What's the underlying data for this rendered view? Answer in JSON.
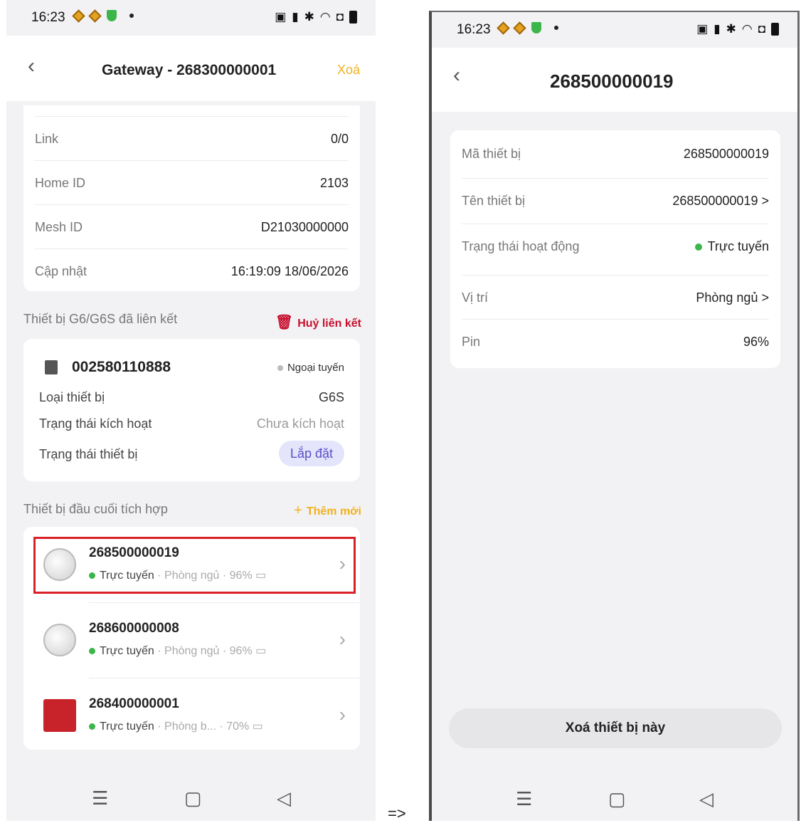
{
  "transition_arrow": "=>",
  "left": {
    "status": {
      "time": "16:23"
    },
    "header": {
      "title": "Gateway - 268300000001",
      "delete_label": "Xoá"
    },
    "info_rows": [
      {
        "key": "Link",
        "value": "0/0"
      },
      {
        "key": "Home ID",
        "value": "2103"
      },
      {
        "key": "Mesh ID",
        "value": "D21030000000"
      },
      {
        "key": "Cập nhật",
        "value": "16:19:09 18/06/2026"
      }
    ],
    "linked_section": {
      "title": "Thiết bị G6/G6S đã liên kết",
      "action": "Huỷ liên kết"
    },
    "linked_device": {
      "id": "002580110888",
      "status": "Ngoại tuyến",
      "rows": [
        {
          "key": "Loại thiết bị",
          "value": "G6S"
        },
        {
          "key": "Trạng thái kích hoạt",
          "value": "Chưa kích hoạt"
        },
        {
          "key": "Trạng thái thiết bị",
          "value": "Lắp đặt"
        }
      ]
    },
    "end_devices_section": {
      "title": "Thiết bị đầu cuối tích hợp",
      "action": "Thêm mới"
    },
    "end_devices": [
      {
        "id": "268500000019",
        "status": "Trực tuyến",
        "location": "Phòng ngủ",
        "battery": "96%"
      },
      {
        "id": "268600000008",
        "status": "Trực tuyến",
        "location": "Phòng ngủ",
        "battery": "96%"
      },
      {
        "id": "268400000001",
        "status": "Trực tuyến",
        "location": "Phòng b...",
        "battery": "70%"
      }
    ],
    "highlight_color": "#d92128",
    "accent_color": "#f2b01e",
    "danger_color": "#c8102e"
  },
  "right": {
    "status": {
      "time": "16:23"
    },
    "header": {
      "title": "268500000019"
    },
    "rows": [
      {
        "key": "Mã thiết bị",
        "value": "268500000019",
        "chevron": ""
      },
      {
        "key": "Tên thiết bị",
        "value": "268500000019",
        "chevron": ">"
      },
      {
        "key": "Trạng thái hoạt động",
        "value": "Trực tuyến",
        "chevron": ""
      },
      {
        "key": "Vị trí",
        "value": "Phòng ngủ",
        "chevron": ">"
      },
      {
        "key": "Pin",
        "value": "96%",
        "chevron": ""
      }
    ],
    "delete_button": "Xoá thiết bị này"
  }
}
